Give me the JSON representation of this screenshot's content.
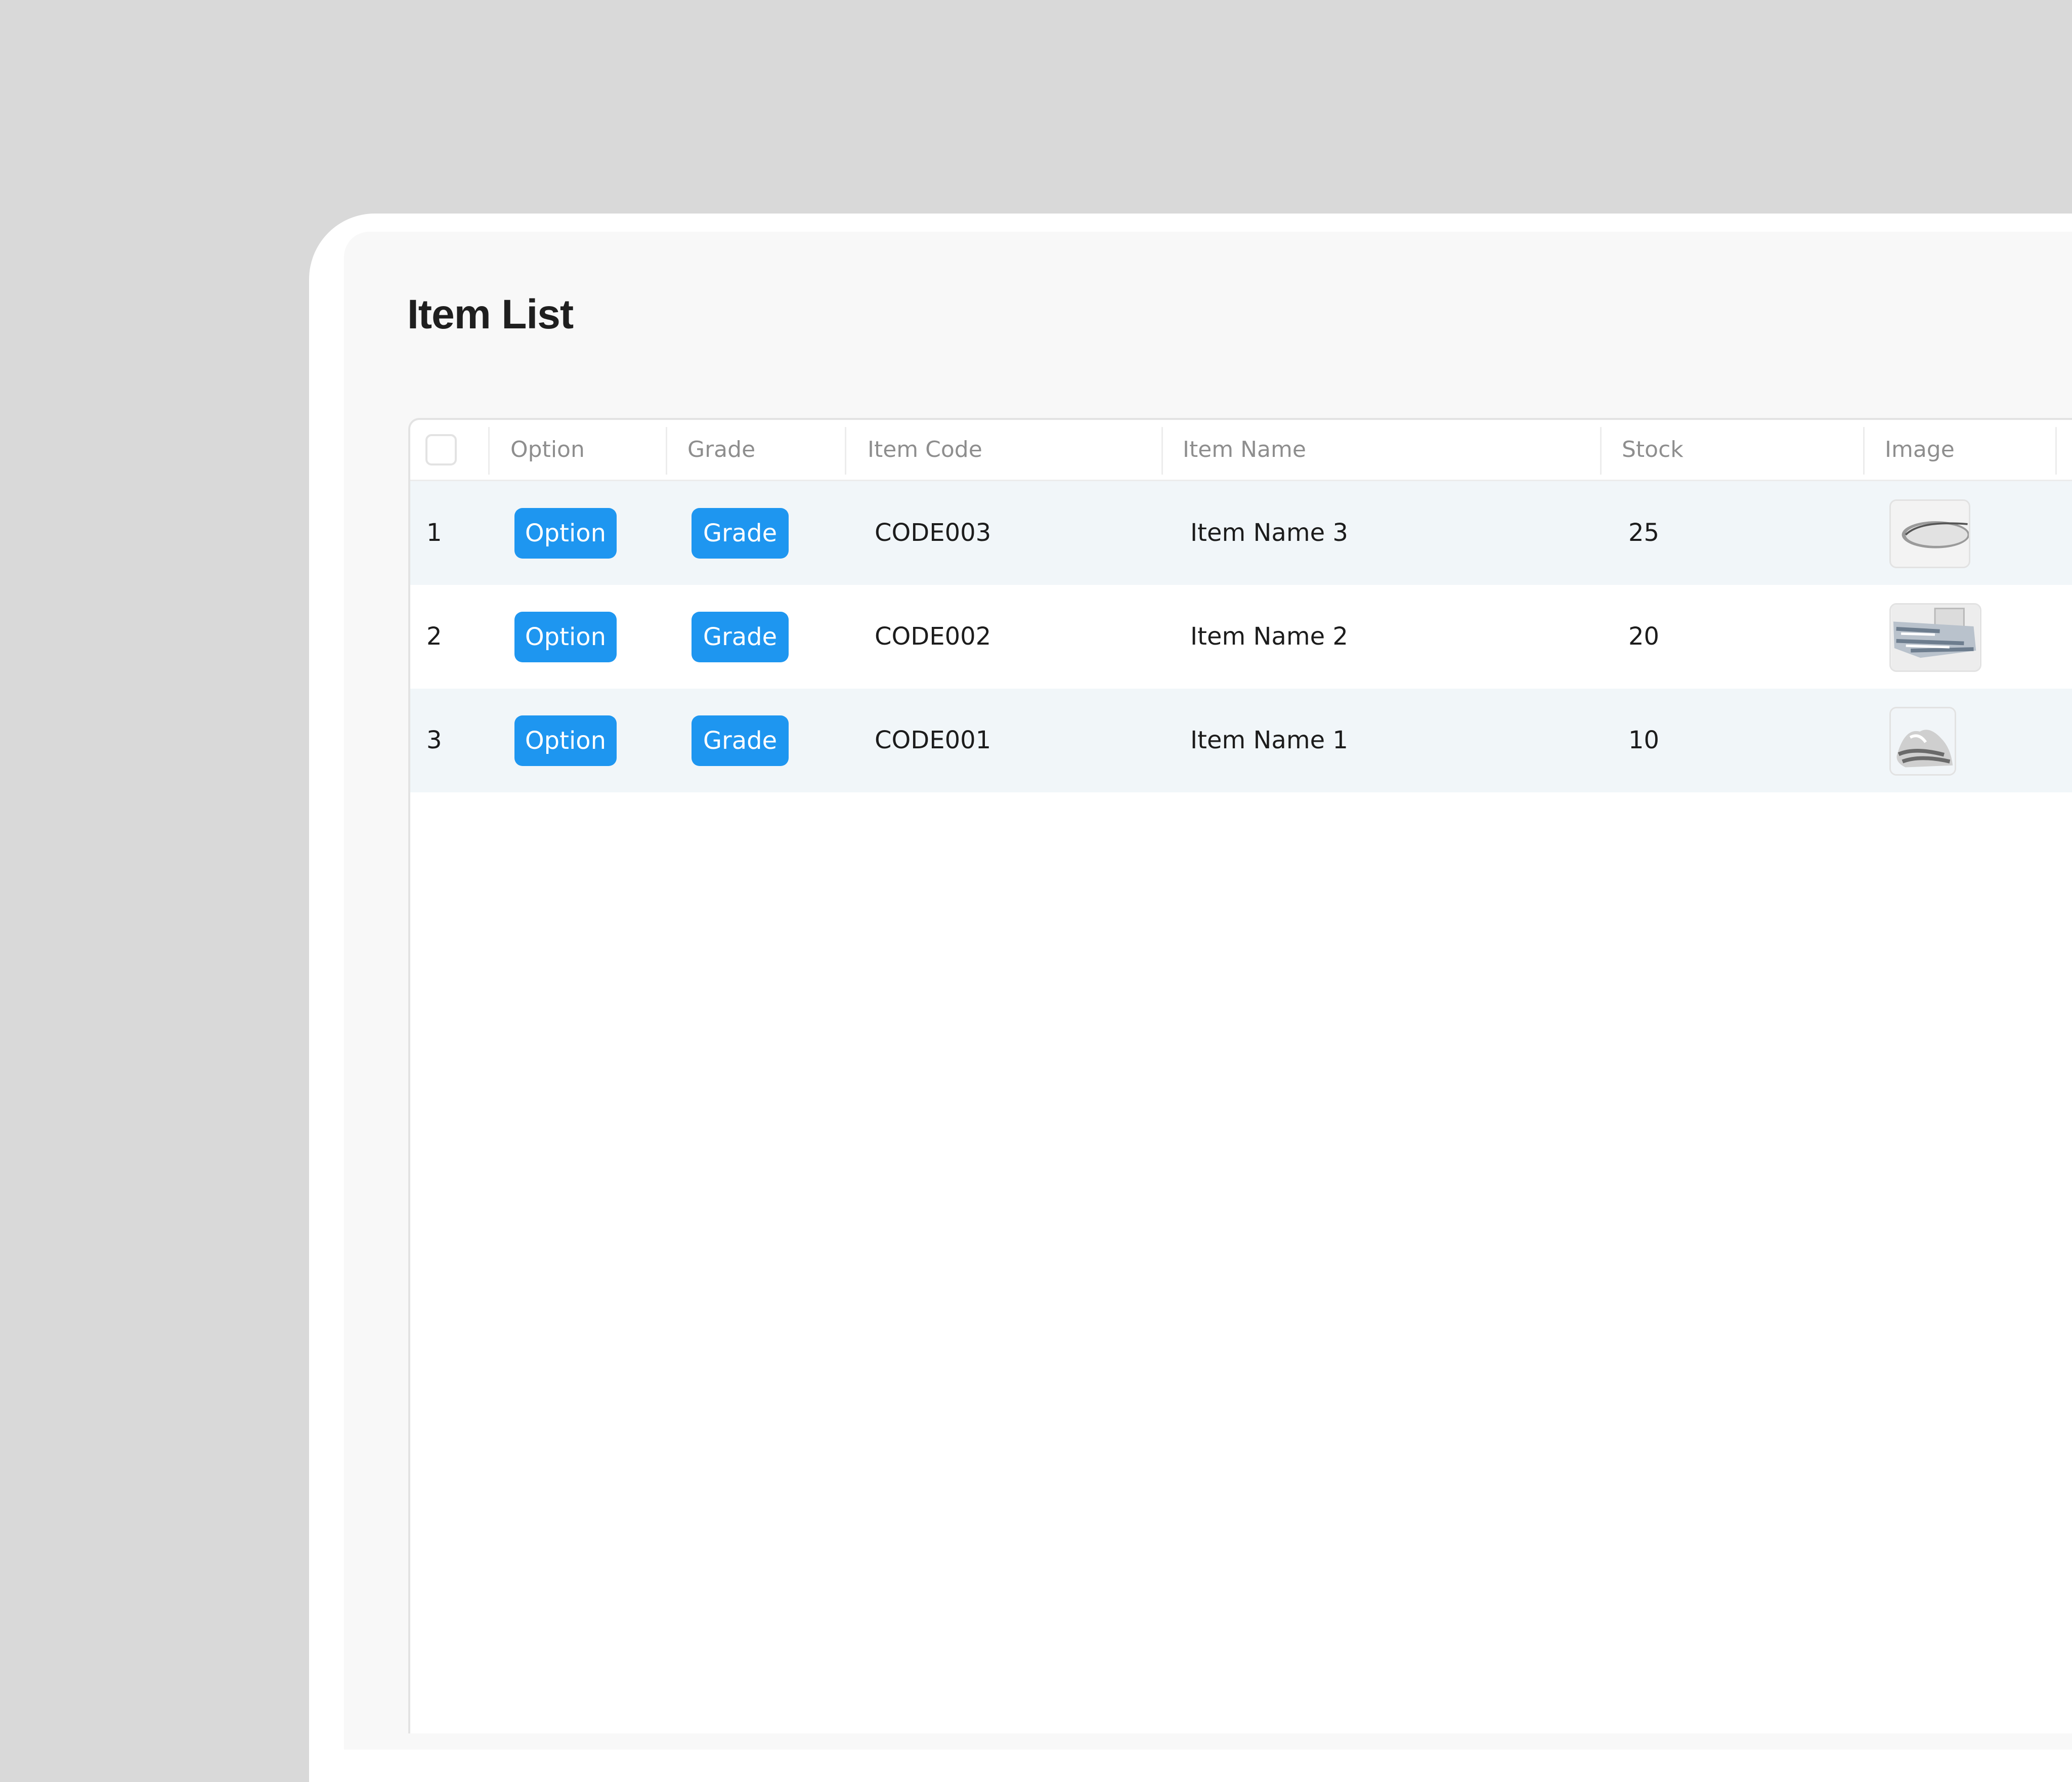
{
  "page": {
    "title": "Item List"
  },
  "table": {
    "columns": [
      {
        "key": "select",
        "label": ""
      },
      {
        "key": "option",
        "label": "Option"
      },
      {
        "key": "grade",
        "label": "Grade"
      },
      {
        "key": "item_code",
        "label": "Item Code"
      },
      {
        "key": "item_name",
        "label": "Item Name"
      },
      {
        "key": "stock",
        "label": "Stock"
      },
      {
        "key": "image",
        "label": "Image"
      },
      {
        "key": "extra",
        "label": ""
      }
    ],
    "rows": [
      {
        "index": "1",
        "option_label": "Option",
        "grade_label": "Grade",
        "item_code": "CODE003",
        "item_name": "Item Name 3",
        "stock": "25",
        "image_icon": "tray-thumbnail"
      },
      {
        "index": "2",
        "option_label": "Option",
        "grade_label": "Grade",
        "item_code": "CODE002",
        "item_name": "Item Name 2",
        "stock": "20",
        "image_icon": "glassware-thumbnail"
      },
      {
        "index": "3",
        "option_label": "Option",
        "grade_label": "Grade",
        "item_code": "CODE001",
        "item_name": "Item Name 1",
        "stock": "10",
        "image_icon": "silver-object-thumbnail"
      }
    ]
  },
  "colors": {
    "background": "#d9d9d9",
    "panel": "#f8f8f8",
    "accent_button": "#1e96f0",
    "row_alt": "#f1f6f9",
    "header_text": "#8e8e8e",
    "body_text": "#1c1c1c"
  }
}
